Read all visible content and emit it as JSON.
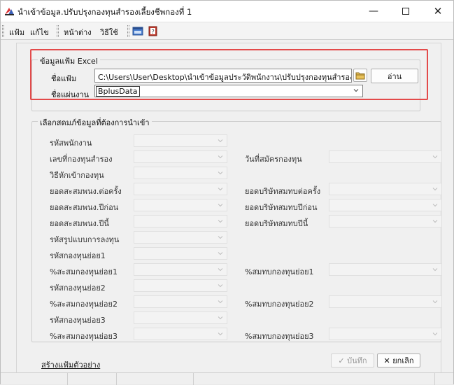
{
  "window": {
    "title": "นำเข้าข้อมูล.ปรับปรุงกองทุนสำรองเลี้ยงชีพกองที่ 1",
    "minimize": "—",
    "close": "✕"
  },
  "menu": {
    "items": [
      "แฟ้ม",
      "แก้ไข",
      "หน้าต่าง",
      "วิธีใช้"
    ]
  },
  "excel_group": {
    "title": "ข้อมูลแฟ้ม Excel",
    "file_label": "ชื่อแฟ้ม",
    "file_path": "C:\\Users\\User\\Desktop\\นำเข้าข้อมูลประวัติพนักงาน\\ปรับปรุงกองทุนสำรองเลี้ยงชีพ.:",
    "read_button": "อ่าน",
    "sheet_label": "ชื่อแผ่นงาน",
    "sheet_value": "BplusData"
  },
  "columns_group": {
    "title": "เลือกสดมภ์ข้อมูลที่ต้องการนำเข้า",
    "left_fields": [
      "รหัสพนักงาน",
      "เลขที่กองทุนสำรอง",
      "วิธีหักเข้ากองทุน",
      "ยอดสะสมพนง.ต่อครั้ง",
      "ยอดสะสมพนง.ปีก่อน",
      "ยอดสะสมพนง.ปีนี้",
      "รหัสรูปแบบการลงทุน",
      "รหัสกองทุนย่อย1",
      "%สะสมกองทุนย่อย1",
      "รหัสกองทุนย่อย2",
      "%สะสมกองทุนย่อย2",
      "รหัสกองทุนย่อย3",
      "%สะสมกองทุนย่อย3"
    ],
    "right_fields": [
      "วันที่สมัครกองทุน",
      "ยอดบริษัทสมทบต่อครั้ง",
      "ยอดบริษัทสมทบปีก่อน",
      "ยอดบริษัทสมทบปีนี้",
      "%สมทบกองทุนย่อย1",
      "%สมทบกองทุนย่อย2",
      "%สมทบกองทุนย่อย3"
    ]
  },
  "footer": {
    "sample_link": "สร้างแฟ้มตัวอย่าง",
    "save_button": "✓ บันทึก",
    "cancel_button": "✕ ยกเลิก"
  },
  "colors": {
    "highlight": "#e34a4a",
    "window_bg": "#f0f0f0"
  }
}
